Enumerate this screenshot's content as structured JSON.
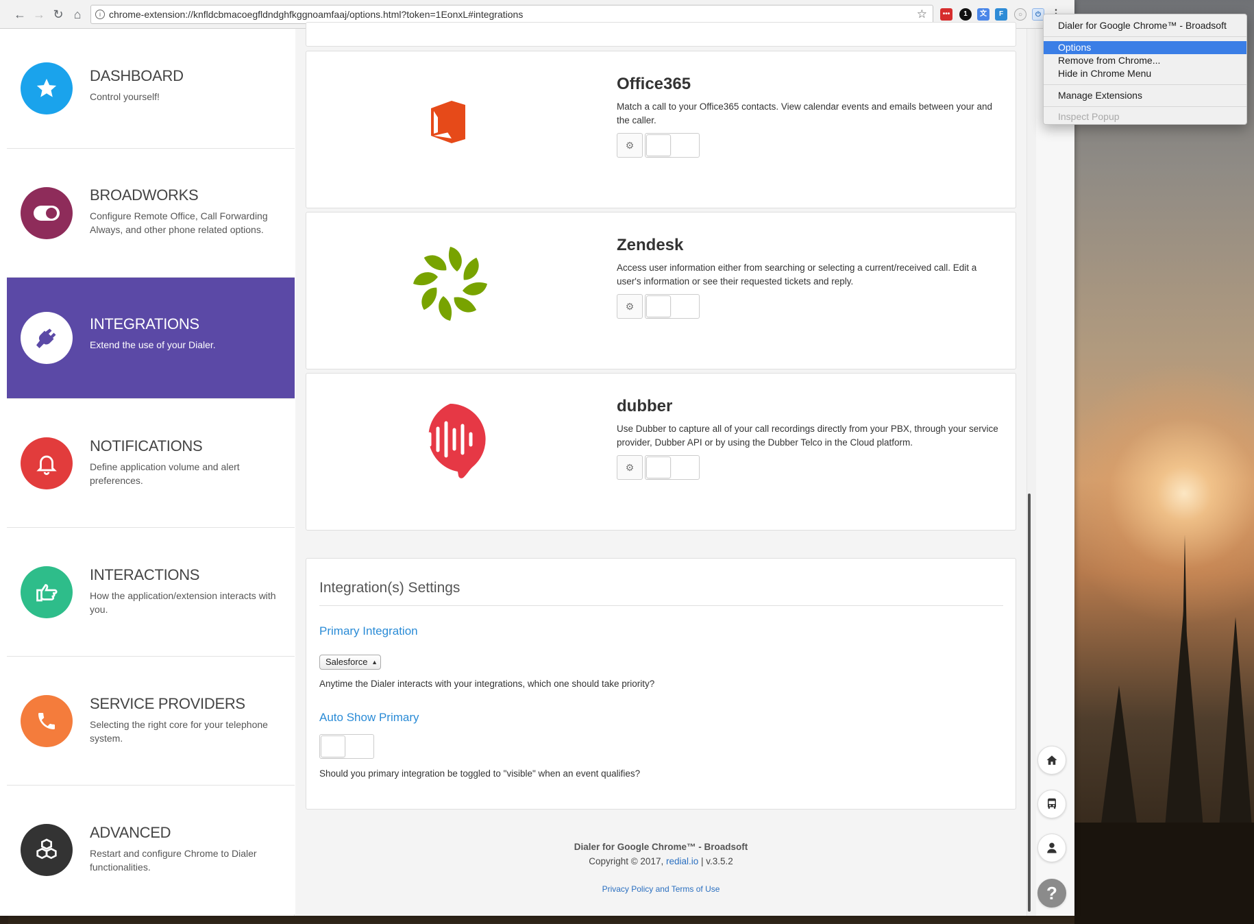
{
  "browser": {
    "url": "chrome-extension://knfldcbmacoegfldndghfkggnoamfaaj/options.html?token=1EonxL#integrations"
  },
  "sidebar": {
    "items": [
      {
        "title": "DASHBOARD",
        "desc": "Control yourself!",
        "color": "#1aa3ec",
        "icon": "star-icon"
      },
      {
        "title": "BROADWORKS",
        "desc": "Configure Remote Office, Call Forwarding Always, and other phone related options.",
        "color": "#8e2c5a",
        "icon": "toggle-icon"
      },
      {
        "title": "INTEGRATIONS",
        "desc": "Extend the use of your Dialer.",
        "color": "#ffffff",
        "icon": "plug-icon"
      },
      {
        "title": "NOTIFICATIONS",
        "desc": "Define application volume and alert preferences.",
        "color": "#e23c3c",
        "icon": "bell-icon"
      },
      {
        "title": "INTERACTIONS",
        "desc": "How the application/extension interacts with you.",
        "color": "#2ebd8a",
        "icon": "hand-pointer-icon"
      },
      {
        "title": "SERVICE PROVIDERS",
        "desc": "Selecting the right core for your telephone system.",
        "color": "#f47c3c",
        "icon": "phone-icon"
      },
      {
        "title": "ADVANCED",
        "desc": "Restart and configure Chrome to Dialer functionalities.",
        "color": "#333333",
        "icon": "cubes-icon"
      }
    ]
  },
  "integrations": [
    {
      "name": "Office365",
      "desc": "Match a call to your Office365 contacts. View calendar events and emails between your and the caller.",
      "enabled": false
    },
    {
      "name": "Zendesk",
      "desc": "Access user information either from searching or selecting a current/received call. Edit a user's information or see their requested tickets and reply.",
      "enabled": false
    },
    {
      "name": "dubber",
      "desc": "Use Dubber to capture all of your call recordings directly from your PBX, through your service provider, Dubber API or by using the Dubber Telco in the Cloud platform.",
      "enabled": false
    }
  ],
  "settings": {
    "title": "Integration(s) Settings",
    "primary_label": "Primary Integration",
    "primary_value": "Salesforce",
    "primary_help": "Anytime the Dialer interacts with your integrations, which one should take priority?",
    "auto_show_label": "Auto Show Primary",
    "auto_show_enabled": false,
    "auto_show_help": "Should you primary integration be toggled to \"visible\" when an event qualifies?"
  },
  "footer": {
    "product": "Dialer for Google Chrome™ - Broadsoft",
    "copyright_prefix": "Copyright © 2017, ",
    "company_link": "redial.io",
    "version": " | v.3.5.2",
    "privacy": "Privacy Policy and Terms of Use"
  },
  "context_menu": {
    "header": "Dialer for Google Chrome™ - Broadsoft",
    "items": [
      "Options",
      "Remove from Chrome...",
      "Hide in Chrome Menu",
      "Manage Extensions",
      "Inspect Popup"
    ]
  }
}
